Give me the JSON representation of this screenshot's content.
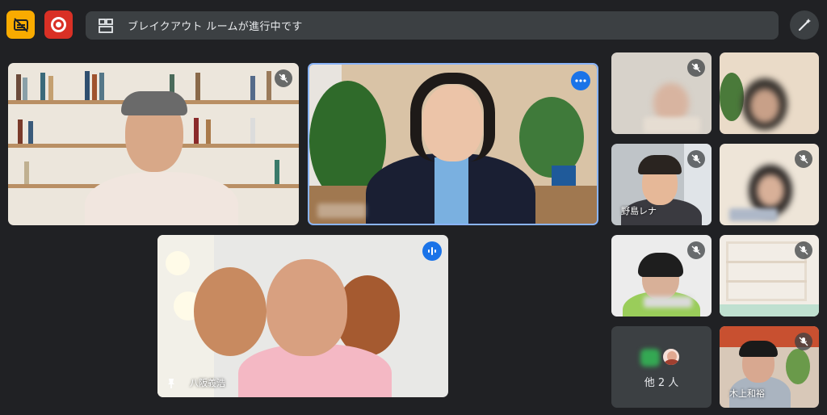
{
  "topbar": {
    "captions_icon": "captions-off-icon",
    "record_icon": "record-icon",
    "breakout_icon": "breakout-rooms-icon",
    "banner_text": "ブレイクアウト ルームが進行中です",
    "effects_icon": "magic-pen-icon"
  },
  "participants": {
    "yasaka": "八阪義浩",
    "nojima": "野島レナ",
    "kimiue": "木上和裕"
  },
  "more_tile": {
    "label": "他 2 人"
  },
  "colors": {
    "captions": "#f9ab00",
    "record": "#d93025",
    "active_speaker": "#1a73e8",
    "background": "#202124"
  }
}
